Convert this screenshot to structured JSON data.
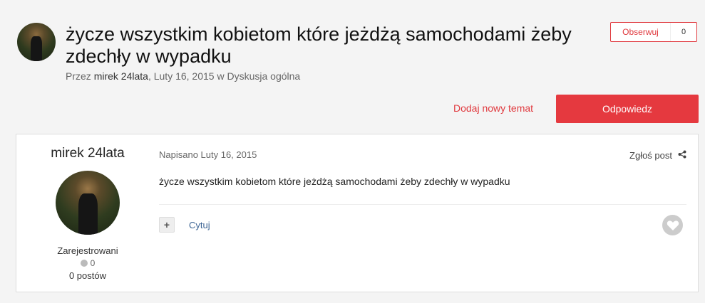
{
  "topic": {
    "title": "życze wszystkim kobietom które jeżdżą samochodami żeby zdechły w wypadku",
    "by_prefix": "Przez",
    "author": "mirek 24lata",
    "date_text": ", Luty 16, 2015 w Dyskusja ogólna"
  },
  "follow": {
    "label": "Obserwuj",
    "count": "0"
  },
  "actions": {
    "new_topic": "Dodaj nowy temat",
    "reply": "Odpowiedz"
  },
  "post": {
    "author": "mirek 24lata",
    "group": "Zarejestrowani",
    "reputation": "0",
    "posts_count": "0 postów",
    "date": "Napisano Luty 16, 2015",
    "report": "Zgłoś post",
    "body": "życze wszystkim kobietom które jeżdżą samochodami żeby zdechły w wypadku",
    "multiquote": "+",
    "quote": "Cytuj"
  },
  "icons": {
    "share": "share-icon",
    "like": "heart-icon",
    "reputation": "reputation-dot-icon"
  }
}
